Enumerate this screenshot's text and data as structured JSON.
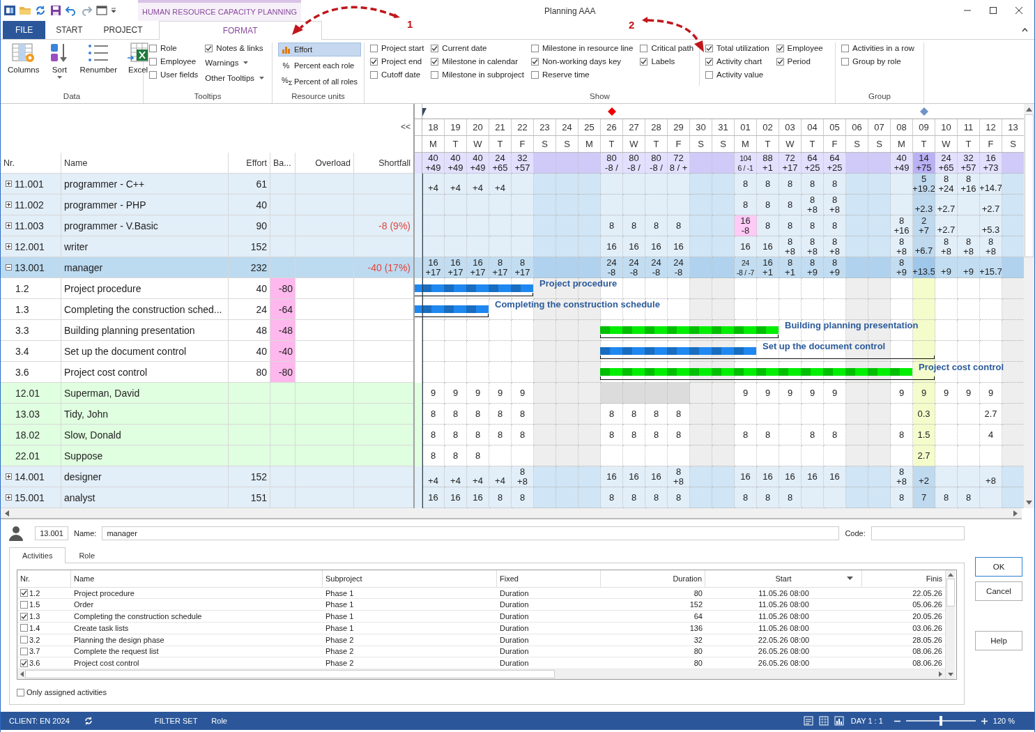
{
  "title_bar": {
    "context_tab": "HUMAN RESOURCE CAPACITY PLANNING",
    "title": "Planning AAA"
  },
  "tabs": [
    {
      "label": "FILE",
      "kind": "file",
      "selected": false
    },
    {
      "label": "START",
      "kind": "plain",
      "selected": false
    },
    {
      "label": "PROJECT",
      "kind": "plain",
      "selected": false
    },
    {
      "label": "FORMAT",
      "kind": "context",
      "selected": true
    }
  ],
  "ribbon": {
    "groups": [
      {
        "label": "Data",
        "sections": [
          [
            [
              {
                "kind": "big",
                "label": "Columns"
              }
            ],
            [
              {
                "kind": "big",
                "label": "Sort",
                "menu": true
              }
            ],
            [
              {
                "kind": "big",
                "label": "Renumber"
              }
            ],
            [
              {
                "kind": "big",
                "label": "Excel"
              }
            ]
          ]
        ]
      },
      {
        "label": "Tooltips",
        "sections": [
          [
            [
              {
                "kind": "check",
                "label": "Role",
                "checked": false
              },
              {
                "kind": "check",
                "label": "Employee",
                "checked": false
              },
              {
                "kind": "check",
                "label": "User fields",
                "checked": false
              }
            ],
            [
              {
                "kind": "check",
                "label": "Notes & links",
                "checked": true
              },
              {
                "kind": "dropdown",
                "label": "Warnings"
              },
              {
                "kind": "dropdown",
                "label": "Other Tooltips"
              }
            ]
          ]
        ]
      },
      {
        "label": "Resource units",
        "sections": [
          [
            [
              {
                "kind": "option",
                "label": "Effort",
                "selected": true
              },
              {
                "kind": "option",
                "label": "Percent each role",
                "glyph": "%",
                "selected": false
              },
              {
                "kind": "option",
                "label": "Percent of all roles",
                "glyph": "%$_{Σ}$",
                "selected": false
              }
            ]
          ]
        ]
      },
      {
        "label": "Show",
        "sections": [
          [
            [
              {
                "kind": "check",
                "label": "Project start",
                "checked": false
              },
              {
                "kind": "check",
                "label": "Project end",
                "checked": true
              },
              {
                "kind": "check",
                "label": "Cutoff date",
                "checked": false
              }
            ],
            [
              {
                "kind": "check",
                "label": "Current date",
                "checked": true
              },
              {
                "kind": "check",
                "label": "Milestone in calendar",
                "checked": true
              },
              {
                "kind": "check",
                "label": "Milestone in subproject",
                "checked": false
              }
            ],
            [
              {
                "kind": "check",
                "label": "Milestone in resource line",
                "checked": false
              },
              {
                "kind": "check",
                "label": "Non-working days key",
                "checked": true
              },
              {
                "kind": "check",
                "label": "Reserve time",
                "checked": false
              }
            ],
            [
              {
                "kind": "check",
                "label": "Critical path",
                "checked": false
              },
              {
                "kind": "check",
                "label": "Labels",
                "checked": true
              }
            ]
          ],
          [
            [
              {
                "kind": "check",
                "label": "Total utilization",
                "checked": true
              },
              {
                "kind": "check",
                "label": "Activity chart",
                "checked": true
              },
              {
                "kind": "check",
                "label": "Activity value",
                "checked": false
              }
            ],
            [
              {
                "kind": "check",
                "label": "Employee",
                "checked": true
              },
              {
                "kind": "check",
                "label": "Period",
                "checked": true
              }
            ]
          ]
        ]
      },
      {
        "label": "Group",
        "sections": [
          [
            [
              {
                "kind": "check",
                "label": "Activities in a row",
                "checked": false
              },
              {
                "kind": "check",
                "label": "Group by role",
                "checked": false
              }
            ]
          ]
        ]
      }
    ]
  },
  "annotations": [
    {
      "label": "1"
    },
    {
      "label": "2"
    }
  ],
  "table": {
    "collapse": "<<",
    "columns": [
      "Nr.",
      "Name",
      "Effort",
      "Ba...",
      "Overload",
      "Shortfall"
    ],
    "rows": [
      {
        "kind": "role",
        "nr": "11.001",
        "name": "programmer - C++",
        "effort": "61",
        "expanded": false,
        "selected": false,
        "cells": {
          "d0": {
            "lower": "+4"
          },
          "d1": {
            "lower": "+4"
          },
          "d2": {
            "lower": "+4"
          },
          "d3": {
            "lower": "+4"
          },
          "d14": "8",
          "d15": "8",
          "d16": "8",
          "d17": "8",
          "d18": "8",
          "d22": {
            "upper": "5",
            "lower": "+19.2"
          },
          "d23": {
            "upper": "8",
            "lower": "+24"
          },
          "d24": {
            "upper": "8",
            "lower": "+16"
          },
          "d25": {
            "lower": "+14.7"
          }
        }
      },
      {
        "kind": "role",
        "nr": "11.002",
        "name": "programmer - PHP",
        "effort": "40",
        "expanded": false,
        "selected": false,
        "cells": {
          "d14": "8",
          "d15": "8",
          "d16": "8",
          "d17": {
            "upper": "8",
            "lower": "+8"
          },
          "d18": {
            "upper": "8",
            "lower": "+8"
          },
          "d22": {
            "lower": "+2.3"
          },
          "d23": {
            "lower": "+2.7"
          },
          "d25": {
            "lower": "+2.7"
          }
        }
      },
      {
        "kind": "role",
        "nr": "11.003",
        "name": "programmer - V.Basic",
        "effort": "90",
        "shortfall": "-8 (9%)",
        "expanded": false,
        "selected": false,
        "cells": {
          "d8": "8",
          "d9": "8",
          "d10": "8",
          "d11": "8",
          "d14": {
            "upper": "16",
            "lower": "-8",
            "overload": true,
            "critical": false
          },
          "d15": "8",
          "d16": "8",
          "d17": "8",
          "d18": "8",
          "d21": {
            "upper": "8",
            "lower": "+16"
          },
          "d22": {
            "upper": "2",
            "lower": "+7"
          },
          "d23": {
            "lower": "+2.7"
          },
          "d25": {
            "lower": "+5.3"
          }
        }
      },
      {
        "kind": "role",
        "nr": "12.001",
        "name": "writer",
        "effort": "152",
        "expanded": false,
        "selected": false,
        "cells": {
          "d8": "16",
          "d9": "16",
          "d10": "16",
          "d11": "16",
          "d14": "16",
          "d15": "16",
          "d16": {
            "upper": "8",
            "lower": "+8"
          },
          "d17": {
            "upper": "8",
            "lower": "+8"
          },
          "d18": {
            "upper": "8",
            "lower": "+8"
          },
          "d21": {
            "upper": "8",
            "lower": "+8"
          },
          "d22": {
            "lower": "+6.7"
          },
          "d23": {
            "upper": "8",
            "lower": "+8"
          },
          "d24": {
            "upper": "8",
            "lower": "+8"
          },
          "d25": {
            "upper": "8",
            "lower": "+8"
          }
        }
      },
      {
        "kind": "role",
        "nr": "13.001",
        "name": "manager",
        "effort": "232",
        "shortfall": "-40 (17%)",
        "expanded": true,
        "selected": true,
        "cells": {
          "d0": {
            "upper": "16",
            "lower": "+17"
          },
          "d1": {
            "upper": "16",
            "lower": "+17"
          },
          "d2": {
            "upper": "16",
            "lower": "+17"
          },
          "d3": {
            "upper": "8",
            "lower": "+17"
          },
          "d4": {
            "upper": "8",
            "lower": "+17"
          },
          "d8": {
            "upper": "24",
            "lower": "-8",
            "overload": true,
            "critical": true
          },
          "d9": {
            "upper": "24",
            "lower": "-8",
            "overload": true,
            "critical": true
          },
          "d10": {
            "upper": "24",
            "lower": "-8",
            "overload": true,
            "critical": true
          },
          "d11": {
            "upper": "24",
            "lower": "-8",
            "overload": true,
            "critical": true
          },
          "d14": {
            "upper": "24",
            "lower": "-8 / -7",
            "overload": true,
            "critical": true
          },
          "d15": {
            "upper": "16",
            "lower": "+1"
          },
          "d16": {
            "upper": "8",
            "lower": "+1"
          },
          "d17": {
            "upper": "8",
            "lower": "+9"
          },
          "d18": {
            "upper": "8",
            "lower": "+9"
          },
          "d21": {
            "upper": "8",
            "lower": "+9"
          },
          "d22": {
            "lower": "+13.5"
          },
          "d23": {
            "lower": "+9"
          },
          "d24": {
            "lower": "+9"
          },
          "d25": {
            "lower": "+15.7"
          }
        }
      },
      {
        "kind": "activity",
        "nr": "1.2",
        "name": "Project procedure",
        "effort": "40",
        "ba": "-80",
        "selected": false,
        "bar_label": "Project procedure",
        "color": "#1e88f0",
        "cells": {
          "d0": {
            "bar": true,
            "bracket": true
          },
          "d1": {
            "bar": true,
            "bracket": true
          },
          "d2": {
            "bar": true,
            "bracket": true
          },
          "d3": {
            "bar": true,
            "bracket": true
          },
          "d4": {
            "bar": true,
            "bracket": true
          }
        }
      },
      {
        "kind": "activity",
        "nr": "1.3",
        "name": "Completing the construction sched...",
        "effort": "24",
        "ba": "-64",
        "selected": false,
        "bar_label": "Completing the construction schedule",
        "color": "#1e88f0",
        "cells": {
          "d0": {
            "bar": true,
            "bracket": true
          },
          "d1": {
            "bar": true,
            "bracket": true
          },
          "d2": {
            "bar": true,
            "bracket": true
          }
        }
      },
      {
        "kind": "activity",
        "nr": "3.3",
        "name": "Building planning presentation",
        "effort": "48",
        "ba": "-48",
        "selected": false,
        "bar_label": "Building planning presentation",
        "color": "#00ee00",
        "cells": {
          "d8": {
            "bar": true,
            "bracket": true
          },
          "d9": {
            "bar": true,
            "bracket": true
          },
          "d10": {
            "bar": true,
            "bracket": true
          },
          "d11": {
            "bar": true,
            "bracket": true
          },
          "d12": {
            "bar": true,
            "bracket": true
          },
          "d13": {
            "bar": true,
            "bracket": true
          },
          "d14": {
            "bar": true,
            "bracket": true
          },
          "d15": {
            "bar": true,
            "bracket": true
          }
        }
      },
      {
        "kind": "activity",
        "nr": "3.4",
        "name": "Set up the document control",
        "effort": "40",
        "ba": "-40",
        "selected": false,
        "bar_label": "Set up the document control",
        "color": "#1e88f0",
        "cells": {
          "d8": {
            "bar": true,
            "bracket": true
          },
          "d9": {
            "bar": true,
            "bracket": true
          },
          "d10": {
            "bar": true,
            "bracket": true
          },
          "d11": {
            "bar": true,
            "bracket": true
          },
          "d12": {
            "bar": true,
            "bracket": true
          },
          "d13": {
            "bar": true,
            "bracket": true
          },
          "d14": {
            "bar": true,
            "bracket": true
          },
          "d15": {
            "bar": false,
            "bracket": true
          },
          "d16": {
            "bar": false,
            "bracket": true
          },
          "d17": {
            "bar": false,
            "bracket": true
          },
          "d18": {
            "bar": false,
            "bracket": true
          },
          "d19": {
            "bar": false,
            "bracket": true
          },
          "d20": {
            "bar": false,
            "bracket": true
          },
          "d21": {
            "bar": false,
            "bracket": true
          },
          "d22": {
            "bar": false,
            "bracket": true
          }
        }
      },
      {
        "kind": "activity",
        "nr": "3.6",
        "name": "Project cost control",
        "effort": "80",
        "ba": "-80",
        "selected": false,
        "bar_label": "Project cost control",
        "color": "#00ee00",
        "cells": {
          "d8": {
            "bar": true,
            "bracket": true
          },
          "d9": {
            "bar": true,
            "bracket": true
          },
          "d10": {
            "bar": true,
            "bracket": true
          },
          "d11": {
            "bar": true,
            "bracket": true
          },
          "d12": {
            "bar": true,
            "bracket": true
          },
          "d13": {
            "bar": true,
            "bracket": true
          },
          "d14": {
            "bar": true,
            "bracket": true
          },
          "d15": {
            "bar": true,
            "bracket": true
          },
          "d16": {
            "bar": true,
            "bracket": true
          },
          "d17": {
            "bar": true,
            "bracket": true
          },
          "d18": {
            "bar": true,
            "bracket": true
          },
          "d19": {
            "bar": true,
            "bracket": true
          },
          "d20": {
            "bar": true,
            "bracket": true
          },
          "d21": {
            "bar": true,
            "bracket": true
          },
          "d22": {
            "bar": false,
            "bracket": true
          }
        }
      },
      {
        "kind": "employee",
        "nr": "12.01",
        "name": "Superman, David",
        "selected": false,
        "cells": {
          "d0": "9",
          "d1": "9",
          "d2": "9",
          "d3": "9",
          "d4": "9",
          "d8": {
            "absent": true
          },
          "d9": {
            "absent": true
          },
          "d10": {
            "absent": true
          },
          "d11": {
            "absent": true
          },
          "d14": "9",
          "d15": "9",
          "d16": "9",
          "d17": "9",
          "d18": "9",
          "d21": "9",
          "d22": "9",
          "d23": "9",
          "d24": "9",
          "d25": "9"
        }
      },
      {
        "kind": "employee",
        "nr": "13.03",
        "name": "Tidy, John",
        "selected": false,
        "cells": {
          "d0": "8",
          "d1": "8",
          "d2": "8",
          "d3": "8",
          "d4": "8",
          "d8": "8",
          "d9": "8",
          "d10": "8",
          "d11": "8",
          "d22": "0.3",
          "d25": "2.7"
        }
      },
      {
        "kind": "employee",
        "nr": "18.02",
        "name": "Slow, Donald",
        "selected": false,
        "cells": {
          "d0": "8",
          "d1": "8",
          "d2": "8",
          "d3": "8",
          "d4": "8",
          "d8": "8",
          "d9": "8",
          "d10": "8",
          "d11": "8",
          "d14": "8",
          "d15": "8",
          "d17": "8",
          "d18": "8",
          "d21": "8",
          "d22": "1.5",
          "d25": "4"
        }
      },
      {
        "kind": "employee",
        "nr": "22.01",
        "name": "Suppose",
        "selected": false,
        "cells": {
          "d0": "8",
          "d1": "8",
          "d2": "8",
          "d22": "2.7"
        }
      },
      {
        "kind": "role",
        "nr": "14.001",
        "name": "designer",
        "effort": "152",
        "expanded": false,
        "selected": false,
        "cells": {
          "d0": {
            "lower": "+4"
          },
          "d1": {
            "lower": "+4"
          },
          "d2": {
            "lower": "+4"
          },
          "d3": {
            "lower": "+4"
          },
          "d4": {
            "upper": "8",
            "lower": "+8"
          },
          "d8": "16",
          "d9": "16",
          "d10": "16",
          "d11": {
            "upper": "8",
            "lower": "+8"
          },
          "d14": "16",
          "d15": "16",
          "d16": "16",
          "d17": "16",
          "d18": "16",
          "d21": {
            "upper": "8",
            "lower": "+8"
          },
          "d22": {
            "lower": "+2"
          },
          "d25": {
            "lower": "+8"
          }
        }
      },
      {
        "kind": "role",
        "nr": "15.001",
        "name": "analyst",
        "effort": "151",
        "expanded": false,
        "selected": false,
        "cells": {
          "d0": "16",
          "d1": "16",
          "d2": "16",
          "d3": "8",
          "d4": "8",
          "d8": "8",
          "d9": "8",
          "d10": "8",
          "d11": "8",
          "d14": "8",
          "d15": "8",
          "d16": "8",
          "d21": "8",
          "d22": "7",
          "d23": "8",
          "d24": "8"
        }
      }
    ]
  },
  "gantt": {
    "days": [
      {
        "date": "18",
        "weekday": "M",
        "nonworking": false,
        "current": false,
        "marker": {
          "kind": "flag",
          "color": "#34495e"
        },
        "total": {
          "upper": "40",
          "lower": "+49"
        }
      },
      {
        "date": "19",
        "weekday": "T",
        "nonworking": false,
        "current": false,
        "total": {
          "upper": "40",
          "lower": "+49"
        }
      },
      {
        "date": "20",
        "weekday": "W",
        "nonworking": false,
        "current": false,
        "total": {
          "upper": "40",
          "lower": "+49"
        }
      },
      {
        "date": "21",
        "weekday": "T",
        "nonworking": false,
        "current": false,
        "total": {
          "upper": "24",
          "lower": "+65"
        }
      },
      {
        "date": "22",
        "weekday": "F",
        "nonworking": false,
        "current": false,
        "total": {
          "upper": "32",
          "lower": "+57"
        }
      },
      {
        "date": "23",
        "weekday": "S",
        "nonworking": true,
        "current": false
      },
      {
        "date": "24",
        "weekday": "S",
        "nonworking": true,
        "current": false
      },
      {
        "date": "25",
        "weekday": "M",
        "nonworking": true,
        "current": false
      },
      {
        "date": "26",
        "weekday": "T",
        "nonworking": false,
        "current": false,
        "marker": {
          "kind": "diamond",
          "color": "#ee0000"
        },
        "total": {
          "upper": "80",
          "lower": "-8 /"
        }
      },
      {
        "date": "27",
        "weekday": "W",
        "nonworking": false,
        "current": false,
        "total": {
          "upper": "80",
          "lower": "-8 /"
        }
      },
      {
        "date": "28",
        "weekday": "T",
        "nonworking": false,
        "current": false,
        "total": {
          "upper": "80",
          "lower": "-8 /"
        }
      },
      {
        "date": "29",
        "weekday": "F",
        "nonworking": false,
        "current": false,
        "total": {
          "upper": "72",
          "lower": "8 / +"
        }
      },
      {
        "date": "30",
        "weekday": "S",
        "nonworking": true,
        "current": false
      },
      {
        "date": "31",
        "weekday": "S",
        "nonworking": true,
        "current": false
      },
      {
        "date": "01",
        "weekday": "M",
        "nonworking": false,
        "current": false,
        "total": {
          "upper": "104",
          "lower": "6 / -1"
        }
      },
      {
        "date": "02",
        "weekday": "T",
        "nonworking": false,
        "current": false,
        "total": {
          "upper": "88",
          "lower": "+1"
        }
      },
      {
        "date": "03",
        "weekday": "W",
        "nonworking": false,
        "current": false,
        "total": {
          "upper": "72",
          "lower": "+17"
        }
      },
      {
        "date": "04",
        "weekday": "T",
        "nonworking": false,
        "current": false,
        "total": {
          "upper": "64",
          "lower": "+25"
        }
      },
      {
        "date": "05",
        "weekday": "F",
        "nonworking": false,
        "current": false,
        "total": {
          "upper": "64",
          "lower": "+25"
        }
      },
      {
        "date": "06",
        "weekday": "S",
        "nonworking": true,
        "current": false
      },
      {
        "date": "07",
        "weekday": "S",
        "nonworking": true,
        "current": false
      },
      {
        "date": "08",
        "weekday": "M",
        "nonworking": false,
        "current": false,
        "total": {
          "upper": "40",
          "lower": "+49"
        }
      },
      {
        "date": "09",
        "weekday": "T",
        "nonworking": false,
        "current": true,
        "marker": {
          "kind": "diamond",
          "color": "#7093c8"
        },
        "total": {
          "upper": "14",
          "lower": "+75"
        }
      },
      {
        "date": "10",
        "weekday": "W",
        "nonworking": false,
        "current": false,
        "total": {
          "upper": "24",
          "lower": "+65"
        }
      },
      {
        "date": "11",
        "weekday": "T",
        "nonworking": false,
        "current": false,
        "total": {
          "upper": "32",
          "lower": "+57"
        }
      },
      {
        "date": "12",
        "weekday": "F",
        "nonworking": false,
        "current": false,
        "total": {
          "upper": "16",
          "lower": "+73"
        }
      },
      {
        "date": "13",
        "weekday": "S",
        "nonworking": true,
        "current": false
      }
    ]
  },
  "detail": {
    "nr": "13.001",
    "name_label": "Name:",
    "name": "manager",
    "code_label": "Code:",
    "tabs": [
      {
        "label": "Activities",
        "selected": true
      },
      {
        "label": "Role",
        "selected": false
      }
    ],
    "columns": [
      {
        "label": "Nr.",
        "sorted": false
      },
      {
        "label": "Name",
        "sorted": false
      },
      {
        "label": "Subproject",
        "sorted": false
      },
      {
        "label": "Fixed",
        "sorted": false
      },
      {
        "label": "Duration",
        "sorted": false
      },
      {
        "label": "Start",
        "sorted": true
      },
      {
        "label": "Finis",
        "sorted": false
      }
    ],
    "rows": [
      {
        "checked": true,
        "nr": "1.2",
        "name": "Project procedure",
        "subproject": "Phase 1",
        "fixed": "Duration",
        "duration": "80",
        "start": "11.05.26 08:00",
        "finish": "22.05.26"
      },
      {
        "checked": false,
        "nr": "1.5",
        "name": "Order",
        "subproject": "Phase 1",
        "fixed": "Duration",
        "duration": "152",
        "start": "11.05.26 08:00",
        "finish": "05.06.26"
      },
      {
        "checked": true,
        "nr": "1.3",
        "name": "Completing the construction schedule",
        "subproject": "Phase 1",
        "fixed": "Duration",
        "duration": "64",
        "start": "11.05.26 08:00",
        "finish": "20.05.26"
      },
      {
        "checked": false,
        "nr": "1.4",
        "name": "Create task lists",
        "subproject": "Phase 1",
        "fixed": "Duration",
        "duration": "136",
        "start": "11.05.26 08:00",
        "finish": "03.06.26"
      },
      {
        "checked": false,
        "nr": "3.2",
        "name": "Planning the design phase",
        "subproject": "Phase 2",
        "fixed": "Duration",
        "duration": "32",
        "start": "22.05.26 08:00",
        "finish": "28.05.26"
      },
      {
        "checked": false,
        "nr": "3.7",
        "name": "Complete the request list",
        "subproject": "Phase 2",
        "fixed": "Duration",
        "duration": "80",
        "start": "26.05.26 08:00",
        "finish": "08.06.26"
      },
      {
        "checked": true,
        "nr": "3.6",
        "name": "Project cost control",
        "subproject": "Phase 2",
        "fixed": "Duration",
        "duration": "80",
        "start": "26.05.26 08:00",
        "finish": "08.06.26"
      }
    ],
    "only_assigned": {
      "label": "Only assigned activities",
      "checked": false
    },
    "buttons": [
      {
        "label": "OK",
        "kind": "default"
      },
      {
        "label": "Cancel",
        "kind": "plain"
      },
      {
        "label": "Help",
        "kind": "help"
      }
    ]
  },
  "status_bar": {
    "client": "CLIENT: EN 2024",
    "filter": "FILTER SET",
    "role": "Role",
    "day": "DAY 1 : 1",
    "zoom": {
      "level": 0.5,
      "reading": "120 %"
    }
  }
}
